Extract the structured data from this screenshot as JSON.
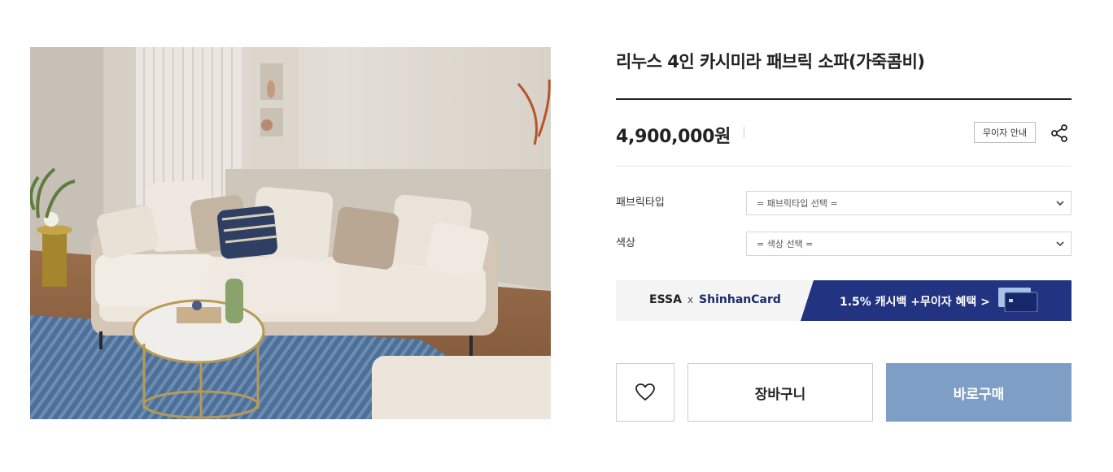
{
  "product": {
    "title": "리누스 4인 카시미라 패브릭 소파(가죽콤비)",
    "price": "4,900,000원",
    "image_description_icon": "sofa-photo"
  },
  "actions": {
    "installment_label": "무이자 안내",
    "share_icon": "share-icon",
    "wishlist_icon": "heart-icon",
    "cart_label": "장바구니",
    "buy_label": "바로구매"
  },
  "options": [
    {
      "label": "패브릭타입",
      "placeholder": "= 패브릭타입 선택 ="
    },
    {
      "label": "색상",
      "placeholder": "= 색상 선택 ="
    }
  ],
  "banner": {
    "brand": "ESSA",
    "separator": "x",
    "partner": "ShinhanCard",
    "promo": "1.5% 캐시백 +무이자 혜택  >"
  },
  "colors": {
    "buy_button": "#7e9ec5",
    "banner_blue": "#213381",
    "text_dark": "#222222"
  }
}
